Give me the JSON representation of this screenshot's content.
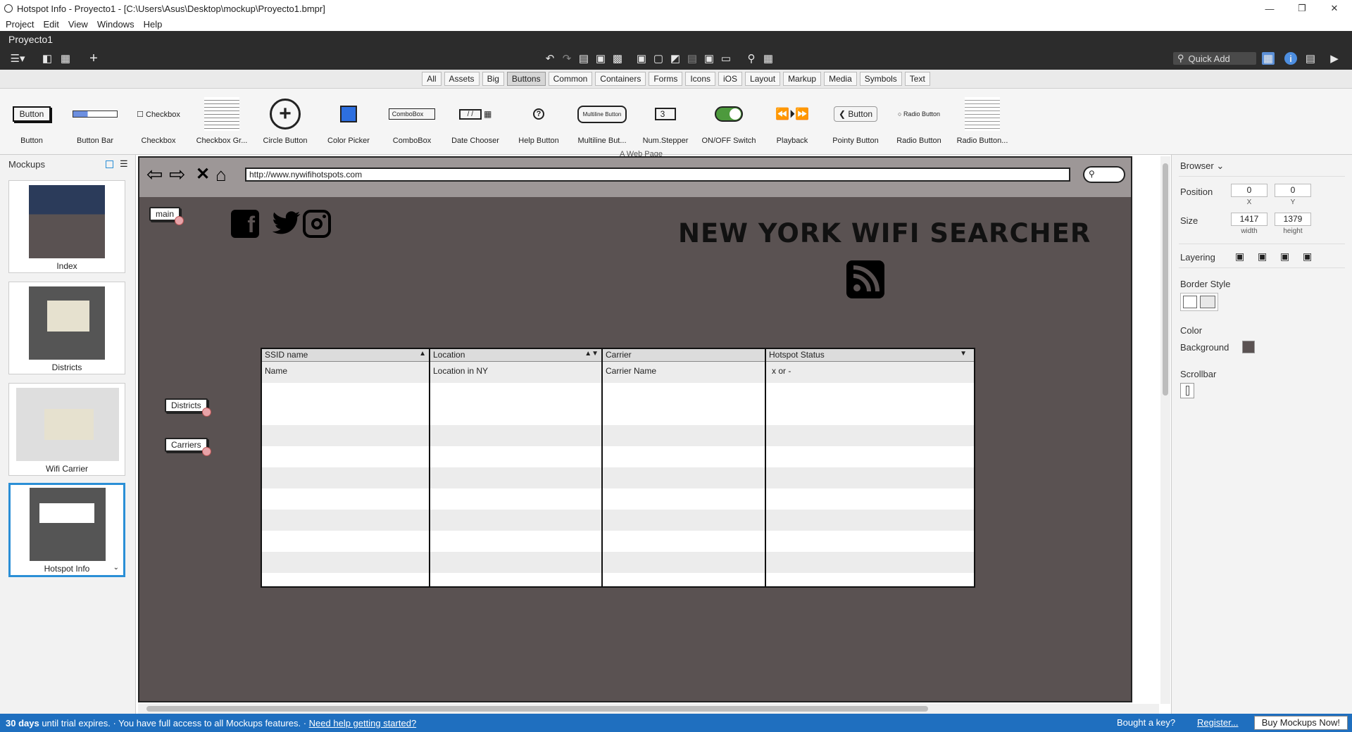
{
  "window": {
    "title": "Hotspot Info - Proyecto1 - [C:\\Users\\Asus\\Desktop\\mockup\\Proyecto1.bmpr]"
  },
  "menu": [
    "Project",
    "Edit",
    "View",
    "Windows",
    "Help"
  ],
  "project": {
    "name": "Proyecto1"
  },
  "quick_add": {
    "placeholder": "Quick Add"
  },
  "categories": [
    "All",
    "Assets",
    "Big",
    "Buttons",
    "Common",
    "Containers",
    "Forms",
    "Icons",
    "iOS",
    "Layout",
    "Markup",
    "Media",
    "Symbols",
    "Text"
  ],
  "active_category": "Buttons",
  "library": [
    {
      "label": "Button",
      "preview": "Button"
    },
    {
      "label": "Button Bar",
      "preview": ""
    },
    {
      "label": "Checkbox",
      "preview": "Checkbox"
    },
    {
      "label": "Checkbox Gr...",
      "preview": ""
    },
    {
      "label": "Circle Button",
      "preview": "+"
    },
    {
      "label": "Color Picker",
      "preview": ""
    },
    {
      "label": "ComboBox",
      "preview": "ComboBox"
    },
    {
      "label": "Date Chooser",
      "preview": "/ /"
    },
    {
      "label": "Help Button",
      "preview": "?"
    },
    {
      "label": "Multiline But...",
      "preview": "Multiline Button"
    },
    {
      "label": "Num.Stepper",
      "preview": "3"
    },
    {
      "label": "ON/OFF Switch",
      "preview": ""
    },
    {
      "label": "Playback",
      "preview": "⏪⏵⏩"
    },
    {
      "label": "Pointy Button",
      "preview": "Button"
    },
    {
      "label": "Radio Button",
      "preview": "Radio Button"
    },
    {
      "label": "Radio Button...",
      "preview": ""
    }
  ],
  "mockups_panel": {
    "title": "Mockups",
    "items": [
      {
        "name": "Index",
        "selected": false
      },
      {
        "name": "Districts",
        "selected": false
      },
      {
        "name": "Wifi Carrier",
        "selected": false
      },
      {
        "name": "Hotspot Info",
        "selected": true
      }
    ]
  },
  "mockup": {
    "page_label": "A Web Page",
    "url": "http://www.nywifihotspots.com",
    "heading": "NEW YORK WIFI SEARCHER",
    "notes": {
      "main": "main",
      "districts": "Districts",
      "carriers": "Carriers"
    },
    "social_icons": [
      "facebook-icon",
      "twitter-icon",
      "instagram-icon"
    ],
    "grid": {
      "columns": [
        "SSID name",
        "Location",
        "Carrier",
        "Hotspot Status"
      ],
      "first_row": [
        "Name",
        "Location in NY",
        "Carrier Name",
        "x or -"
      ]
    }
  },
  "properties": {
    "title": "Browser",
    "position_label": "Position",
    "x": "0",
    "y": "0",
    "x_label": "X",
    "y_label": "Y",
    "size_label": "Size",
    "width": "1417",
    "height": "1379",
    "width_label": "width",
    "height_label": "height",
    "layering_label": "Layering",
    "border_style_label": "Border Style",
    "color_label": "Color",
    "background_label": "Background",
    "scrollbar_label": "Scrollbar"
  },
  "status": {
    "trial_bold": "30 days",
    "trial_text": " until trial expires. · You have full access to all Mockups features. · ",
    "help_link": "Need help getting started?",
    "key_text": "Bought a key? ",
    "register_link": "Register...",
    "buy_button": "Buy Mockups Now!"
  },
  "colors": {
    "accent": "#1f6fbf",
    "canvas_bg": "#5a5252",
    "toolbar_dark": "#2c2c2c"
  }
}
